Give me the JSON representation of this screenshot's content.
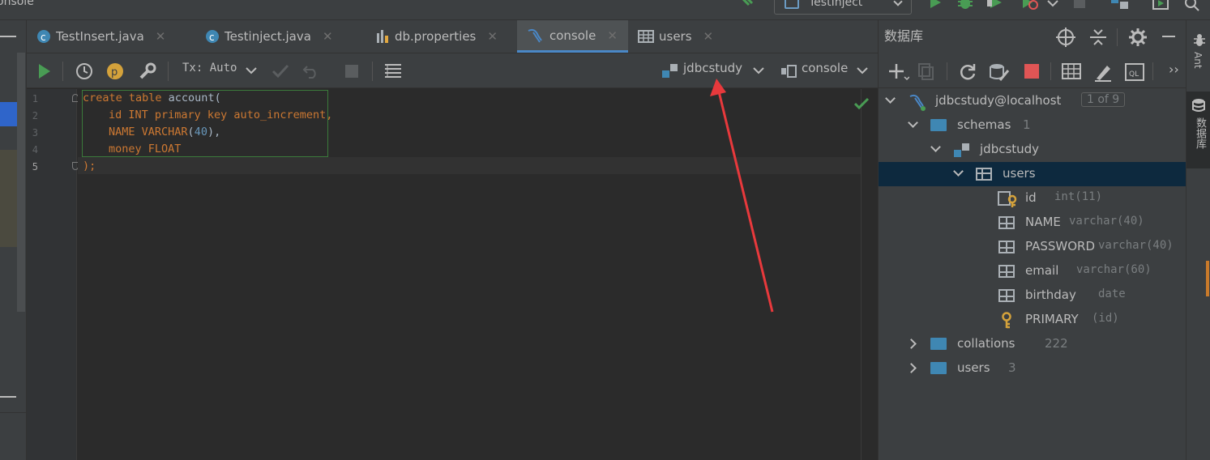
{
  "topbar": {
    "project_name": "onsole",
    "run_config": "TestInject"
  },
  "tabs": [
    {
      "label": "TestInsert.java",
      "icon": "java-class-icon",
      "active": false
    },
    {
      "label": "Testinject.java",
      "icon": "java-class-icon",
      "active": false
    },
    {
      "label": "db.properties",
      "icon": "properties-icon",
      "active": false
    },
    {
      "label": "console",
      "icon": "mysql-console-icon",
      "active": true
    },
    {
      "label": "users",
      "icon": "table-icon",
      "active": false
    }
  ],
  "editor_toolbar": {
    "tx_mode": "Tx: Auto",
    "schema_selector": "jdbcstudy",
    "session_selector": "console"
  },
  "editor": {
    "line_numbers": [
      "1",
      "2",
      "3",
      "4",
      "5"
    ],
    "lines": [
      {
        "kw1": "create table ",
        "rest": "account("
      },
      {
        "name": "id ",
        "kw": "INT primary key auto_increment",
        "end": ","
      },
      {
        "name": "NAME ",
        "kw": "VARCHAR",
        "open": "(",
        "num": "40",
        "end": "),"
      },
      {
        "name": "money ",
        "kw": "FLOAT"
      },
      {
        "end": ");"
      }
    ]
  },
  "db_panel": {
    "title": "数据库",
    "tree": {
      "connection": {
        "label": "jdbcstudy@localhost",
        "badge": "1 of 9"
      },
      "schemas": {
        "label": "schemas",
        "count": "1"
      },
      "schema": {
        "label": "jdbcstudy"
      },
      "table": {
        "label": "users"
      },
      "columns": [
        {
          "name": "id",
          "type": "int(11)",
          "icon": "primary-key-column-icon"
        },
        {
          "name": "NAME",
          "type": "varchar(40)",
          "icon": "column-icon"
        },
        {
          "name": "PASSWORD",
          "type": "varchar(40)",
          "icon": "column-icon"
        },
        {
          "name": "email",
          "type": "varchar(60)",
          "icon": "column-icon"
        },
        {
          "name": "birthday",
          "type": "date",
          "icon": "column-icon"
        },
        {
          "name": "PRIMARY",
          "type": "(id)",
          "icon": "key-icon"
        }
      ],
      "collations": {
        "label": "collations",
        "count": "222"
      },
      "users_folder": {
        "label": "users",
        "count": "3"
      }
    }
  },
  "right_strip": {
    "ant_label": "Ant",
    "db_label": "数据库"
  },
  "colors": {
    "accent": "#4a88c7",
    "run_green": "#499c54",
    "annotation_red": "#e8393c"
  }
}
